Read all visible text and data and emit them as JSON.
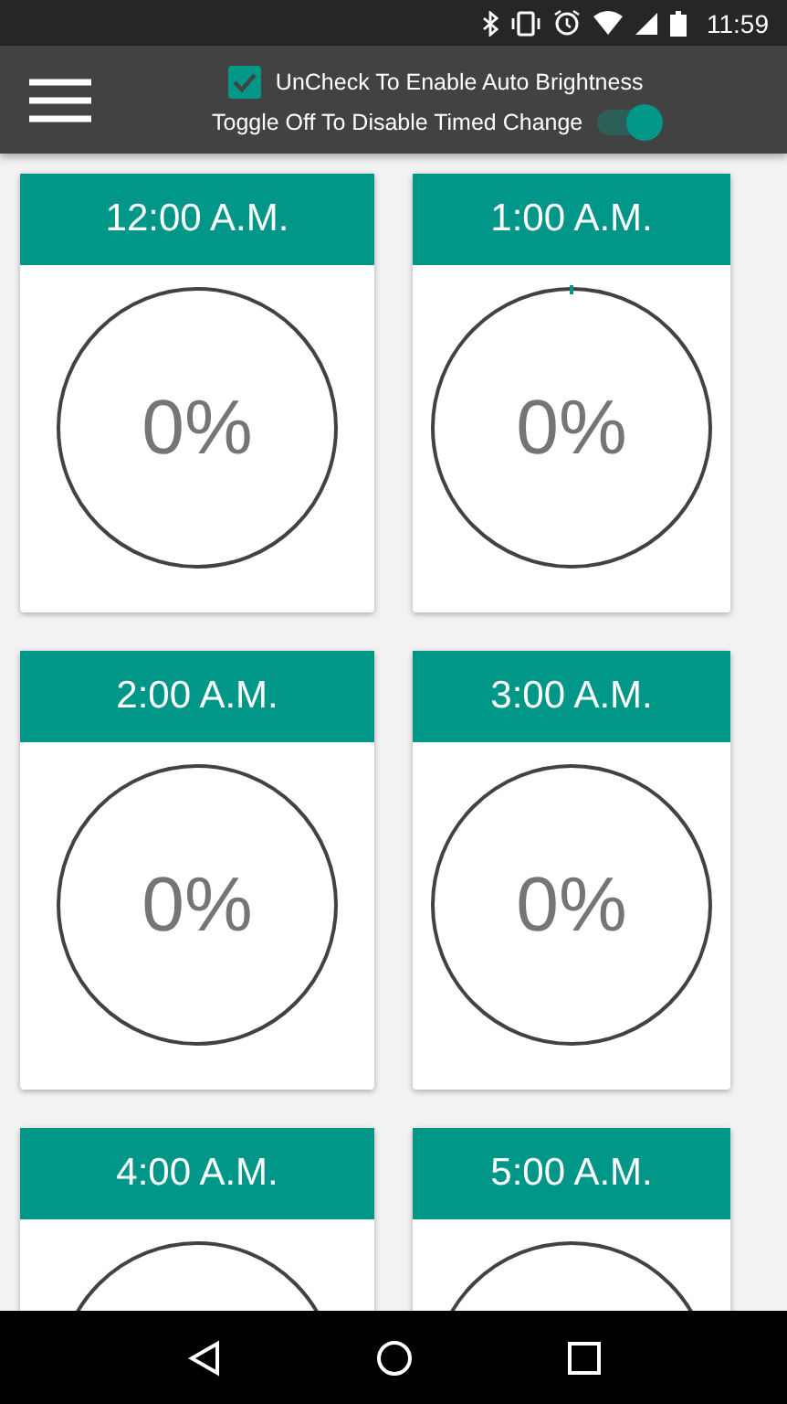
{
  "status_bar": {
    "time": "11:59"
  },
  "toolbar": {
    "auto_brightness": {
      "label": "UnCheck To Enable Auto Brightness",
      "checked": true
    },
    "timed_change": {
      "label": "Toggle Off To Disable Timed Change",
      "on": true
    }
  },
  "cards": [
    {
      "time": "12:00 A.M.",
      "reading": "0%",
      "marker": false
    },
    {
      "time": "1:00 A.M.",
      "reading": "0%",
      "marker": true
    },
    {
      "time": "2:00 A.M.",
      "reading": "0%",
      "marker": false
    },
    {
      "time": "3:00 A.M.",
      "reading": "0%",
      "marker": false
    },
    {
      "time": "4:00 A.M.",
      "marker": false
    },
    {
      "time": "5:00 A.M.",
      "marker": false
    }
  ]
}
